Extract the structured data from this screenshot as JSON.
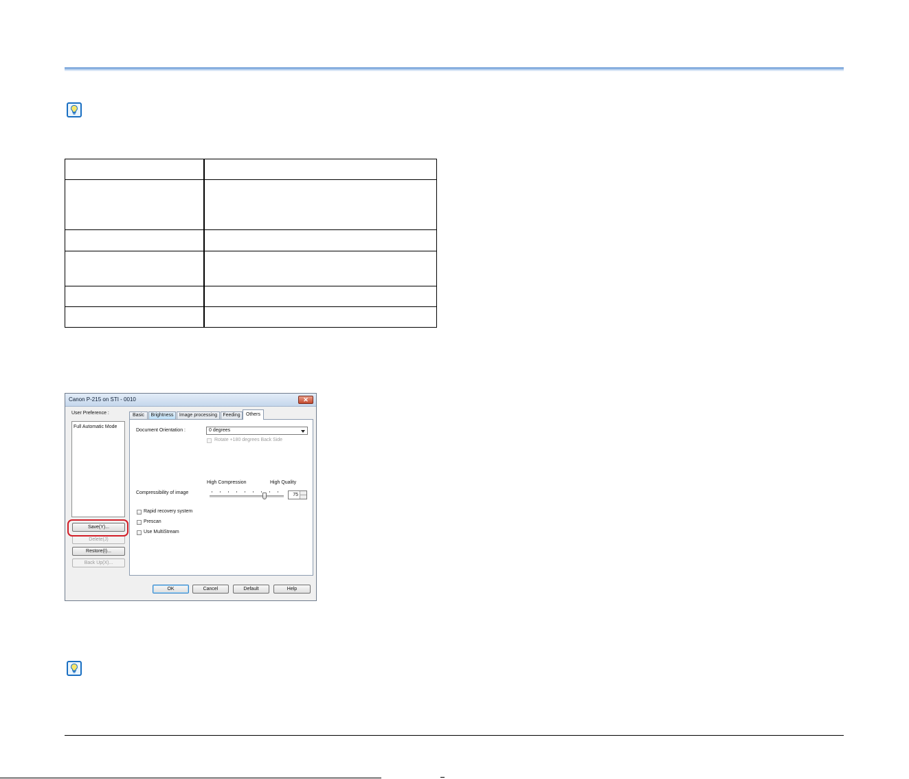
{
  "dialog": {
    "title": "Canon P-215 on STI - 0010",
    "close_label": "✕",
    "user_preference_label": "User Preference :",
    "user_preference_items": [
      "Full Automatic Mode"
    ],
    "buttons": {
      "save": "Save(Y)...",
      "delete": "Delete(J)",
      "restore": "Restore(I)...",
      "backup": "Back Up(X)..."
    },
    "tabs": [
      "Basic",
      "Brightness",
      "Image processing",
      "Feeding",
      "Others"
    ],
    "active_tab": "Others",
    "others": {
      "document_orientation_label": "Document Orientation :",
      "document_orientation_value": "0 degrees",
      "rotate_back_label": "Rotate +180 degrees Back Side",
      "compressibility_label": "Compressibility of image",
      "high_compression_label": "High Compression",
      "high_quality_label": "High Quality",
      "compression_value": "75",
      "rapid_recovery_label": "Rapid recovery system",
      "prescan_label": "Prescan",
      "multistream_label": "Use MultiStream"
    },
    "footer_buttons": {
      "ok": "OK",
      "cancel": "Cancel",
      "default": "Default",
      "help": "Help"
    }
  },
  "colors": {
    "header_rule": "#5a8fd0",
    "tip_icon_border": "#1a6fc2",
    "highlight": "#d21e28"
  },
  "icons": {
    "tip": "lightbulb-icon"
  }
}
